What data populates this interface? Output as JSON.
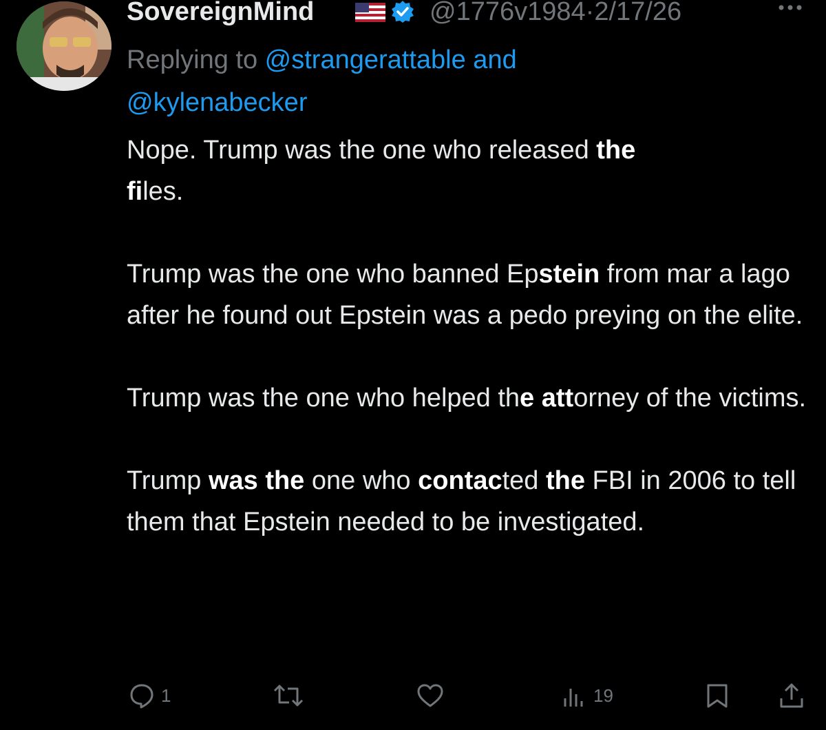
{
  "author": {
    "display_name": "SovereignMind",
    "flag": "🇺🇸",
    "handle": "@1776v1984",
    "separator": "·",
    "date": "2/17/26",
    "verified_color": "#1d9bf0"
  },
  "reply": {
    "prefix": "Replying to ",
    "user1": "@strangerattable",
    "conjunction": " and",
    "user2": "@kylenabecker"
  },
  "body": {
    "p1": {
      "s1": "Nope. Trump was the one who released ",
      "b1": "the",
      "s2": " ",
      "b2": "fi",
      "s3": "les."
    },
    "p2": {
      "s1": "Trump was the one who banned Ep",
      "b1": "stein",
      "s2": " from mar a lago after he found out Epstein was a pedo preying on the elite."
    },
    "p3": {
      "s1": "Trump was the one who helped th",
      "b1": "e att",
      "s2": "orney of the victims."
    },
    "p4": {
      "s1": "Trump ",
      "b1": "was the",
      "s2": " one who ",
      "b2": "contac",
      "s3": "ted ",
      "b3": "the",
      "s4": " FBI in 2006 to tell them that Epstein needed to be investigated."
    }
  },
  "actions": {
    "reply_count": "1",
    "retweet_count": "",
    "like_count": "",
    "views_count": "19"
  },
  "colors": {
    "background": "#000000",
    "text": "#e7e9ea",
    "muted": "#71767b",
    "link": "#1d9bf0"
  },
  "icons": {
    "reply": "reply-icon",
    "retweet": "retweet-icon",
    "like": "heart-icon",
    "views": "views-icon",
    "bookmark": "bookmark-icon",
    "share": "share-icon",
    "more": "more-icon",
    "verified": "verified-badge-icon"
  }
}
